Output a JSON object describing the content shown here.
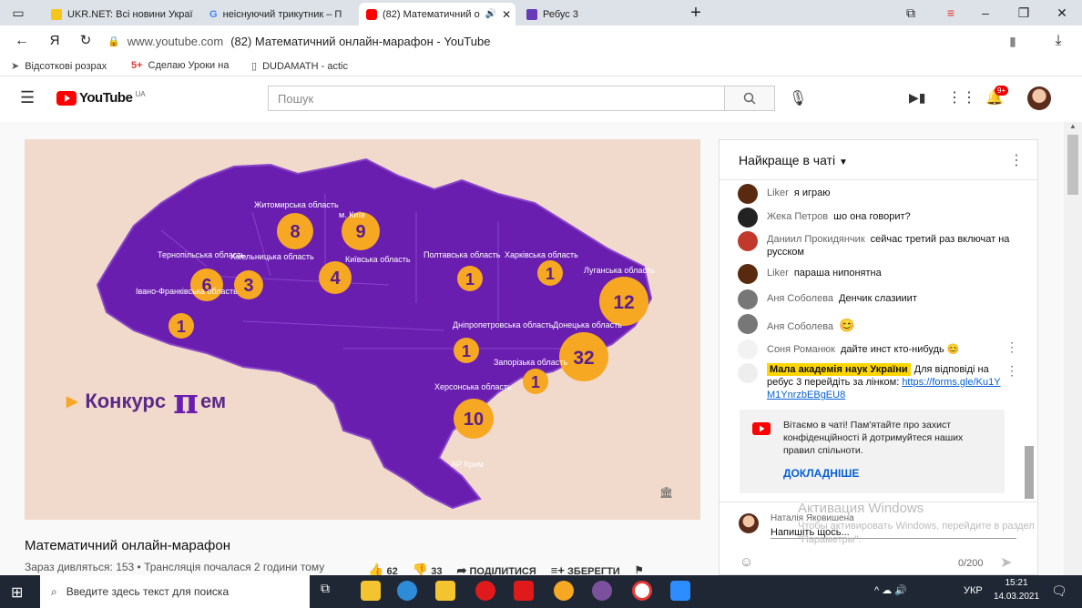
{
  "tabs": [
    {
      "label": "UKR.NET: Всі новини Украї",
      "color": "#f5c518"
    },
    {
      "label": "неіснуючий трикутник – П",
      "color": "#4285f4"
    },
    {
      "label": "(82) Математичний о",
      "color": "#ff0000"
    },
    {
      "label": "Ребус 3",
      "color": "#673ab7"
    }
  ],
  "address": {
    "ya": "Я",
    "domain": "www.youtube.com",
    "title": "(82) Математичний онлайн-марафон - YouTube"
  },
  "bookmarks": [
    {
      "label": "Відсоткові розрах"
    },
    {
      "label": "Сделаю Уроки на",
      "badge": "5+"
    },
    {
      "label": "DUDAMATH - actic"
    }
  ],
  "youtube": {
    "logo": "YouTube",
    "region": "UA",
    "search_placeholder": "Пошук",
    "notif_count": "9+"
  },
  "video": {
    "brand": "Конкурс",
    "brand_pi": "π",
    "brand_tail": "ем",
    "regions": [
      {
        "name": "Житомирська область",
        "value": "8"
      },
      {
        "name": "м. Київ",
        "value": "9"
      },
      {
        "name": "Тернопільська область",
        "value": "6"
      },
      {
        "name": "Хмельницька область",
        "value": "3"
      },
      {
        "name": "Київська область",
        "value": "4"
      },
      {
        "name": "Полтавська область",
        "value": "1"
      },
      {
        "name": "Харківська область",
        "value": "1"
      },
      {
        "name": "Луганська область",
        "value": "12"
      },
      {
        "name": "Івано-Франківська область",
        "value": "1"
      },
      {
        "name": "Дніпропетровська область",
        "value": "1"
      },
      {
        "name": "Донецька область",
        "value": "32"
      },
      {
        "name": "Запорізька область",
        "value": "1"
      },
      {
        "name": "Херсонська область",
        "value": "10"
      },
      {
        "name": "АР Крим",
        "value": ""
      }
    ]
  },
  "video_info": {
    "title": "Математичний онлайн-марафон",
    "meta": "Зараз дивляться: 153 • Трансляція почалася 2 години тому",
    "likes": "62",
    "dislikes": "33",
    "share": "ПОДІЛИТИСЯ",
    "save": "ЗБЕРЕГТИ"
  },
  "chat": {
    "header": "Найкраще в чаті",
    "messages": [
      {
        "author": "Liker",
        "text": "я играю",
        "color": "#5a2a10"
      },
      {
        "author": "Жека Петров",
        "text": "шо она говорит?",
        "color": "#222"
      },
      {
        "author": "Даниил Прокидянчик",
        "text": "сейчас третий раз включат на русском",
        "color": "#c0392b"
      },
      {
        "author": "Liker",
        "text": "параша нипонятна",
        "color": "#5a2a10"
      },
      {
        "author": "Аня Соболева",
        "text": "Денчик слазииит",
        "color": "#777"
      },
      {
        "author": "Аня Соболева",
        "text": "",
        "color": "#777"
      },
      {
        "author": "Соня Романюк",
        "text": "дайте инст кто-нибудь",
        "color": "#f2f2f2"
      }
    ],
    "owner_author": "Мала академія наук України",
    "owner_text": "Для відповіді на ребус 3 перейдіть за лінком:",
    "owner_link": "https://forms.gle/Ku1YM1YnrzbEBgEU8",
    "notice": "Вітаємо в чаті! Пам'ятайте про захист конфіденційності й дотримуйтеся наших правил спільноти.",
    "notice_link": "ДОКЛАДНІШЕ",
    "input_user": "Наталія Яковишена",
    "input_placeholder": "Напишіть щось...",
    "counter": "0/200",
    "watermark_title": "Активация Windows",
    "watermark_text": "Чтобы активировать Windows, перейдите в раздел \"Параметры\"."
  },
  "taskbar": {
    "search": "Введите здесь текст для поиска",
    "lang": "УКР",
    "time": "15:21",
    "date": "14.03.2021"
  }
}
